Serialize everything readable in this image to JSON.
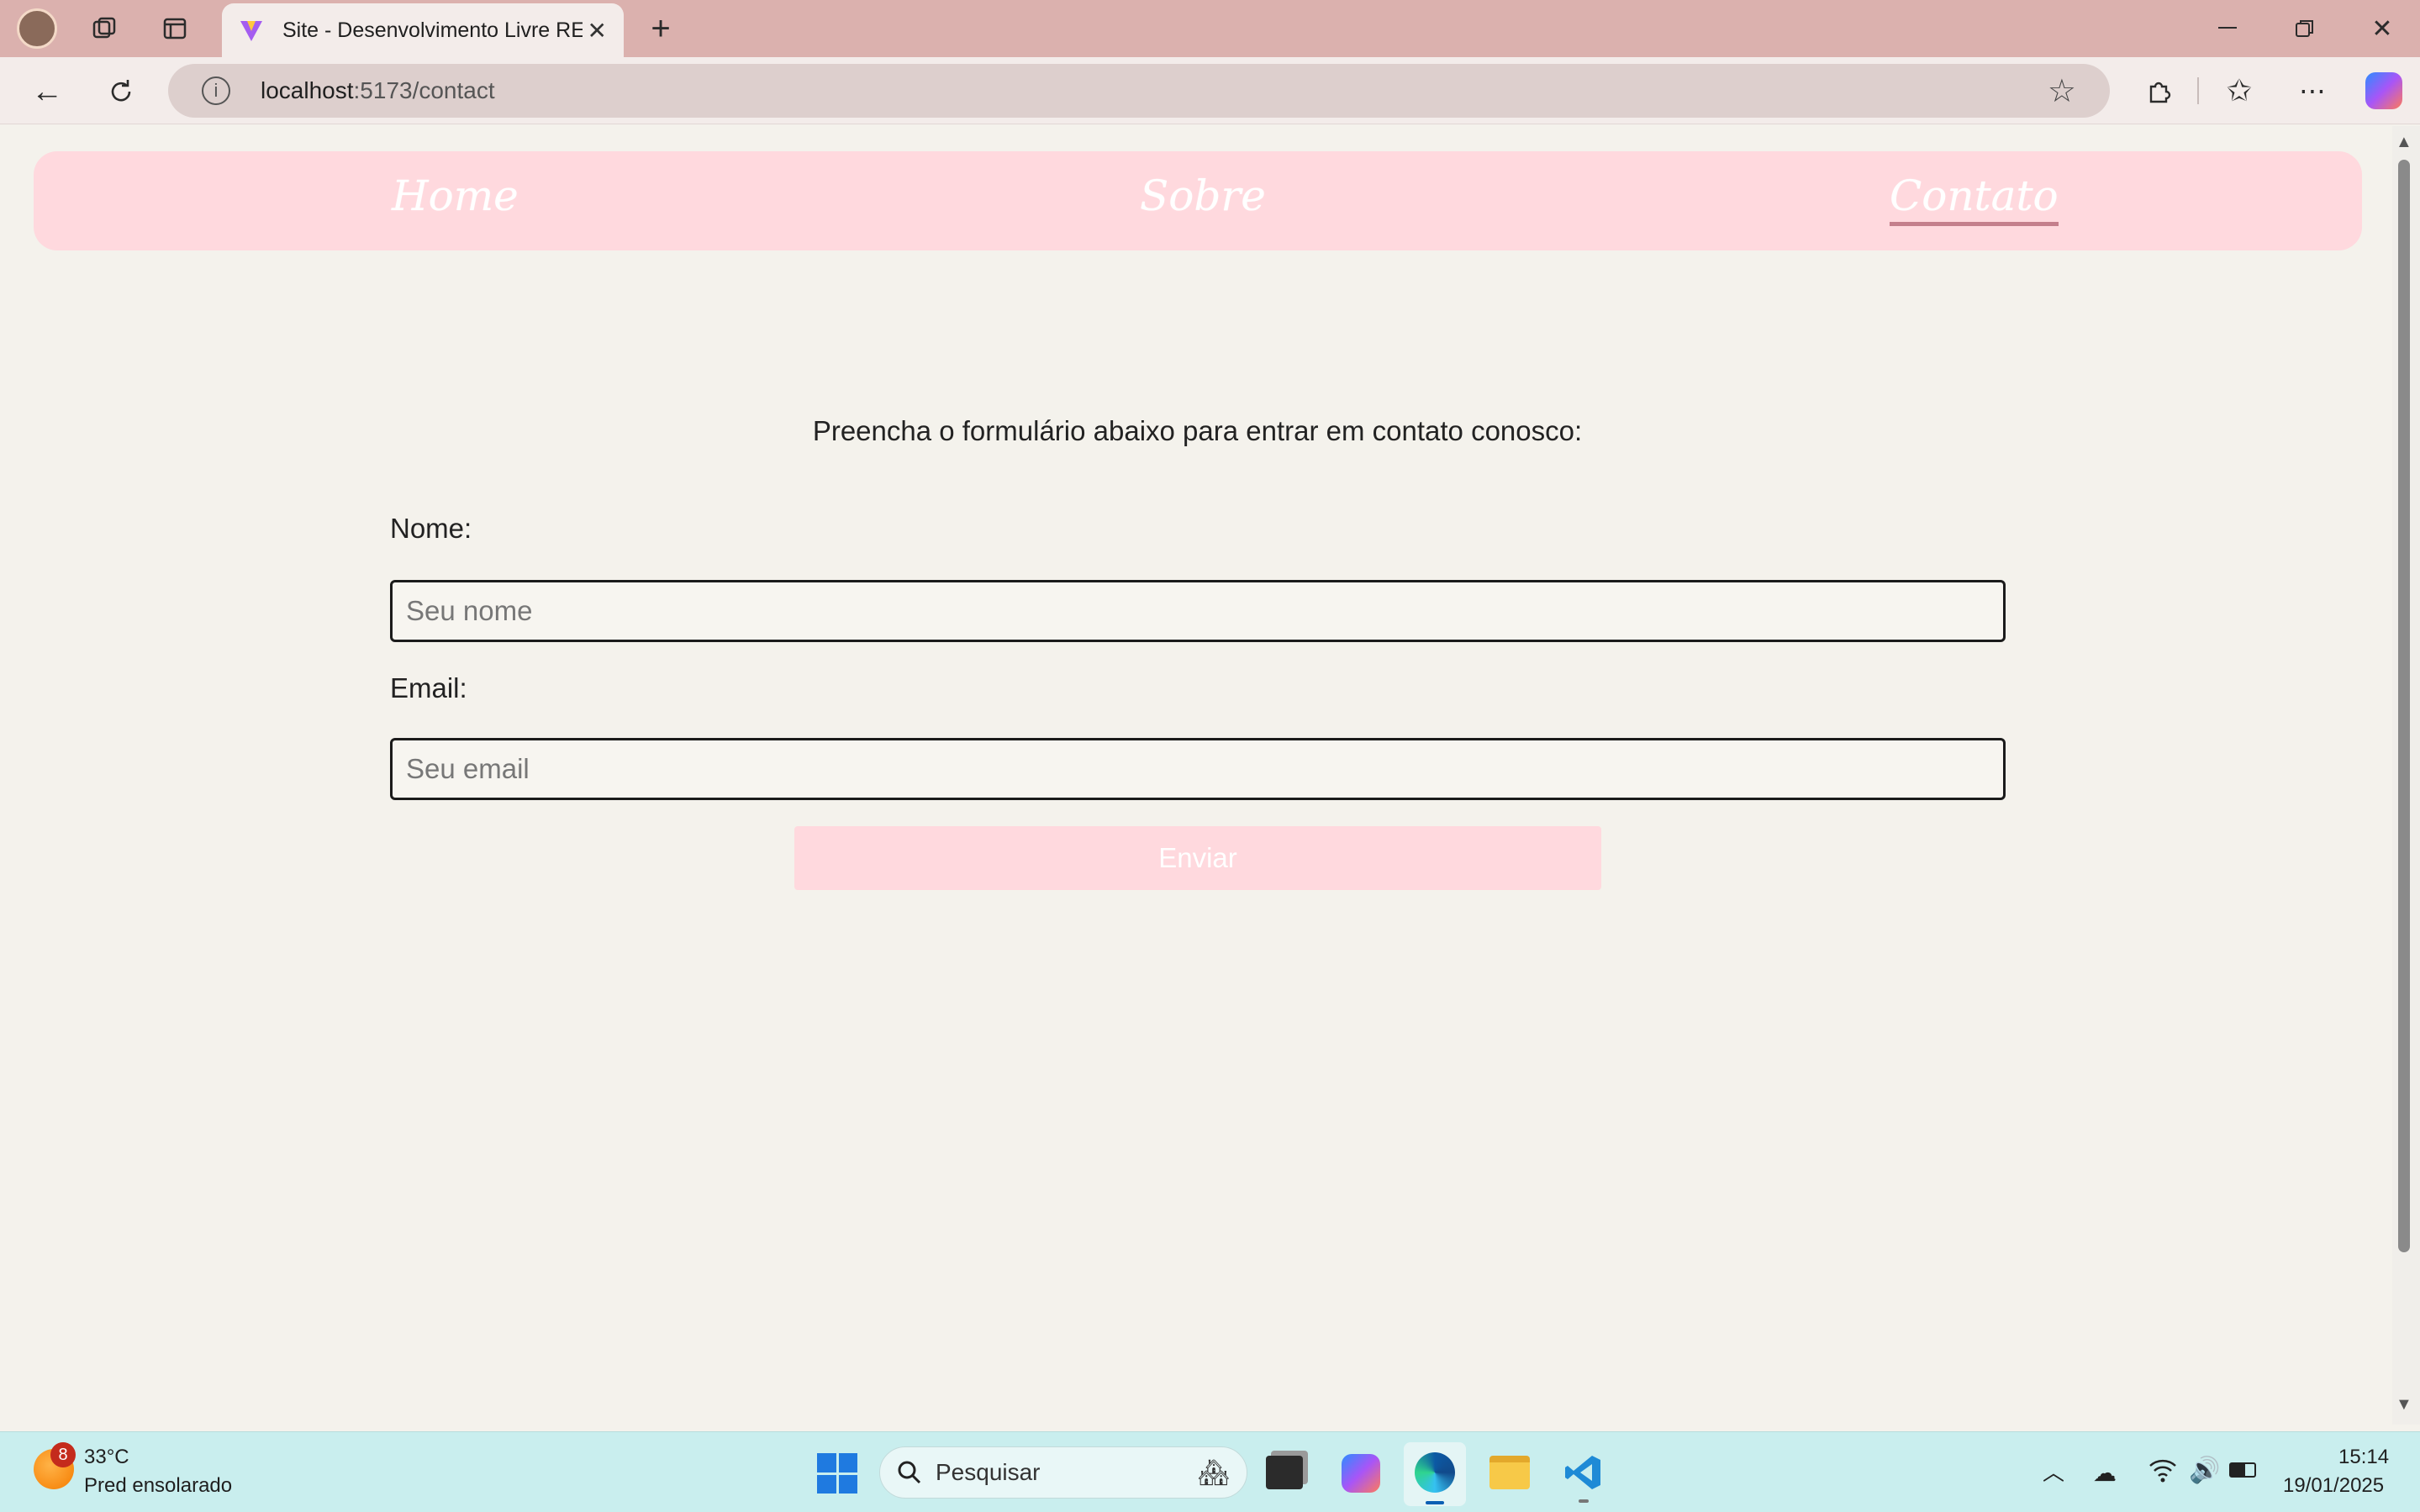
{
  "browser": {
    "tab_title": "Site - Desenvolvimento Livre REACT",
    "url_host": "localhost",
    "url_path": ":5173/contact"
  },
  "nav": {
    "links": [
      {
        "label": "Home"
      },
      {
        "label": "Sobre"
      },
      {
        "label": "Contato"
      }
    ],
    "active": "Contato"
  },
  "form": {
    "intro": "Preencha o formulário abaixo para entrar em contato conosco:",
    "name_label": "Nome:",
    "name_placeholder": "Seu nome",
    "email_label": "Email:",
    "email_placeholder": "Seu email",
    "submit_label": "Enviar"
  },
  "taskbar": {
    "weather_temp": "33°C",
    "weather_desc": "Pred ensolarado",
    "weather_badge": "8",
    "search_placeholder": "Pesquisar",
    "time": "15:14",
    "date": "19/01/2025"
  },
  "colors": {
    "nav_bg": "#ffd9de",
    "page_bg": "#f4f2ec",
    "titlebar": "#dbb1ae",
    "taskbar": "#c9eeee"
  }
}
